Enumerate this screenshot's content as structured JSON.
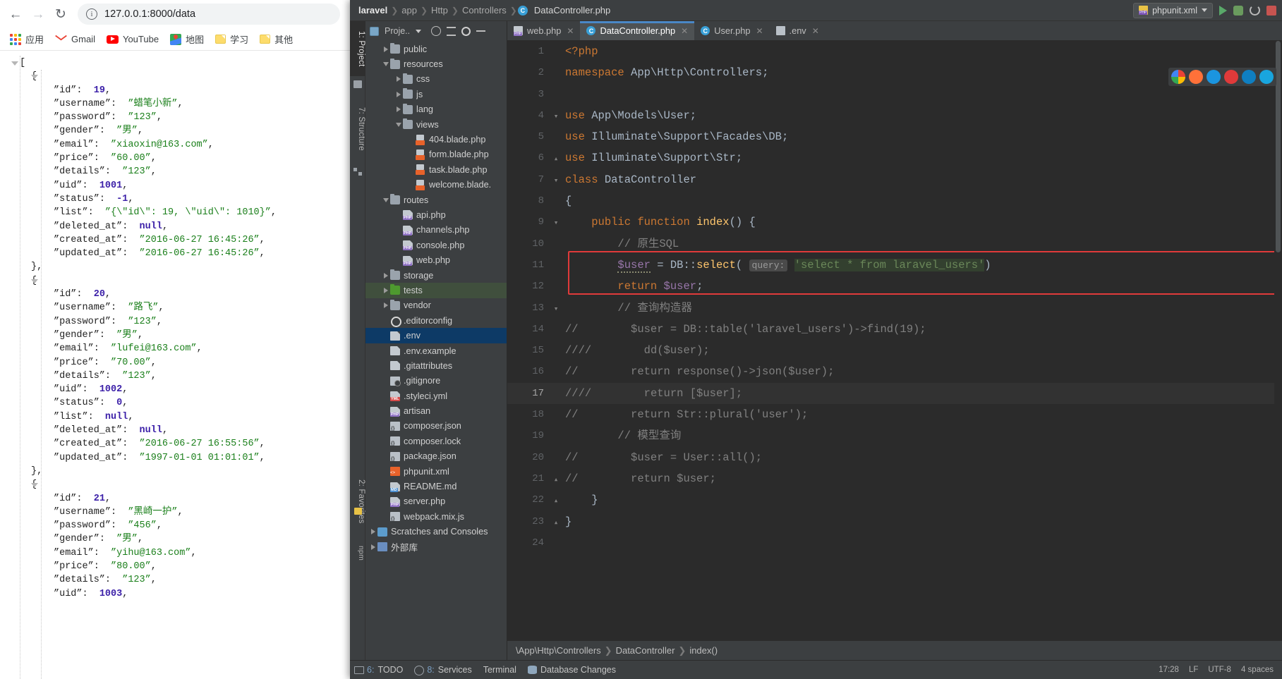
{
  "browser": {
    "nav": {
      "back_icon": "arrow-left",
      "forward_icon": "arrow-right",
      "reload_icon": "reload"
    },
    "omnibox": {
      "info_icon": "info-circle",
      "url": "127.0.0.1:8000/data"
    },
    "bookmarks": [
      {
        "label": "应用",
        "icon": "apps-grid-icon"
      },
      {
        "label": "Gmail",
        "icon": "gmail-icon"
      },
      {
        "label": "YouTube",
        "icon": "youtube-icon"
      },
      {
        "label": "地图",
        "icon": "maps-icon"
      },
      {
        "label": "学习",
        "icon": "folder-icon"
      },
      {
        "label": "其他",
        "icon": "folder-icon"
      }
    ],
    "json_response": [
      {
        "id": 19,
        "username": "蜡笔小新",
        "password": "123",
        "gender": "男",
        "email": "xiaoxin@163.com",
        "price": "60.00",
        "details": "123",
        "uid": 1001,
        "status": -1,
        "list": "{\\\"id\\\": 19, \\\"uid\\\": 1010}",
        "deleted_at": null,
        "created_at": "2016-06-27 16:45:26",
        "updated_at": "2016-06-27 16:45:26"
      },
      {
        "id": 20,
        "username": "路飞",
        "password": "123",
        "gender": "男",
        "email": "lufei@163.com",
        "price": "70.00",
        "details": "123",
        "uid": 1002,
        "status": 0,
        "list": null,
        "deleted_at": null,
        "created_at": "2016-06-27 16:55:56",
        "updated_at": "1997-01-01 01:01:01"
      },
      {
        "id": 21,
        "username": "黑崎一护",
        "password": "456",
        "gender": "男",
        "email": "yihu@163.com",
        "price": "80.00",
        "details": "123",
        "uid": 1003
      }
    ]
  },
  "ide": {
    "breadcrumb": {
      "items": [
        "laravel",
        "app",
        "Http",
        "Controllers"
      ],
      "file": "DataController.php"
    },
    "run_config": {
      "label": "phpunit.xml",
      "caret_icon": "chevron-down-icon"
    },
    "run_actions": [
      {
        "name": "run-button",
        "icon": "play-icon"
      },
      {
        "name": "debug-button",
        "icon": "bug-icon"
      },
      {
        "name": "rerun-button",
        "icon": "rerun-icon"
      },
      {
        "name": "stop-button",
        "icon": "stop-icon"
      }
    ],
    "left_strip": [
      {
        "label": "1: Project",
        "active": true
      },
      {
        "label": "7: Structure",
        "active": false
      },
      {
        "label": "2: Favorites",
        "active": false
      },
      {
        "label": "npm",
        "active": false
      }
    ],
    "project_panel": {
      "title": "Proje..",
      "toolbar_icons": [
        "project-view-icon",
        "locate-icon",
        "collapse-all-icon",
        "settings-gear-icon",
        "hide-icon"
      ],
      "tree": [
        {
          "label": "public",
          "indent": 1,
          "twisty": "right",
          "icon": "folder"
        },
        {
          "label": "resources",
          "indent": 1,
          "twisty": "down",
          "icon": "folder"
        },
        {
          "label": "css",
          "indent": 2,
          "twisty": "right",
          "icon": "folder"
        },
        {
          "label": "js",
          "indent": 2,
          "twisty": "right",
          "icon": "folder"
        },
        {
          "label": "lang",
          "indent": 2,
          "twisty": "right",
          "icon": "folder"
        },
        {
          "label": "views",
          "indent": 2,
          "twisty": "down",
          "icon": "folder"
        },
        {
          "label": "404.blade.php",
          "indent": 3,
          "twisty": "none",
          "icon": "blade"
        },
        {
          "label": "form.blade.php",
          "indent": 3,
          "twisty": "none",
          "icon": "blade"
        },
        {
          "label": "task.blade.php",
          "indent": 3,
          "twisty": "none",
          "icon": "blade"
        },
        {
          "label": "welcome.blade.",
          "indent": 3,
          "twisty": "none",
          "icon": "blade"
        },
        {
          "label": "routes",
          "indent": 1,
          "twisty": "down",
          "icon": "folder"
        },
        {
          "label": "api.php",
          "indent": 2,
          "twisty": "none",
          "icon": "php"
        },
        {
          "label": "channels.php",
          "indent": 2,
          "twisty": "none",
          "icon": "php"
        },
        {
          "label": "console.php",
          "indent": 2,
          "twisty": "none",
          "icon": "php"
        },
        {
          "label": "web.php",
          "indent": 2,
          "twisty": "none",
          "icon": "php"
        },
        {
          "label": "storage",
          "indent": 1,
          "twisty": "right",
          "icon": "folder"
        },
        {
          "label": "tests",
          "indent": 1,
          "twisty": "right",
          "icon": "folder-green",
          "green": true
        },
        {
          "label": "vendor",
          "indent": 1,
          "twisty": "right",
          "icon": "folder"
        },
        {
          "label": ".editorconfig",
          "indent": 1,
          "twisty": "none",
          "icon": "gear"
        },
        {
          "label": ".env",
          "indent": 1,
          "twisty": "none",
          "icon": "doc",
          "selected": true
        },
        {
          "label": ".env.example",
          "indent": 1,
          "twisty": "none",
          "icon": "doc"
        },
        {
          "label": ".gitattributes",
          "indent": 1,
          "twisty": "none",
          "icon": "doc"
        },
        {
          "label": ".gitignore",
          "indent": 1,
          "twisty": "none",
          "icon": "git"
        },
        {
          "label": ".styleci.yml",
          "indent": 1,
          "twisty": "none",
          "icon": "yml"
        },
        {
          "label": "artisan",
          "indent": 1,
          "twisty": "none",
          "icon": "php"
        },
        {
          "label": "composer.json",
          "indent": 1,
          "twisty": "none",
          "icon": "json"
        },
        {
          "label": "composer.lock",
          "indent": 1,
          "twisty": "none",
          "icon": "json"
        },
        {
          "label": "package.json",
          "indent": 1,
          "twisty": "none",
          "icon": "json"
        },
        {
          "label": "phpunit.xml",
          "indent": 1,
          "twisty": "none",
          "icon": "xml"
        },
        {
          "label": "README.md",
          "indent": 1,
          "twisty": "none",
          "icon": "md"
        },
        {
          "label": "server.php",
          "indent": 1,
          "twisty": "none",
          "icon": "php"
        },
        {
          "label": "webpack.mix.js",
          "indent": 1,
          "twisty": "none",
          "icon": "json"
        },
        {
          "label": "Scratches and Consoles",
          "indent": 0,
          "twisty": "right",
          "icon": "scratch"
        },
        {
          "label": "外部库",
          "indent": 0,
          "twisty": "right",
          "icon": "lib"
        }
      ]
    },
    "tabs": [
      {
        "label": "web.php",
        "icon": "php-file-icon",
        "active": false
      },
      {
        "label": "DataController.php",
        "icon": "php-class-icon",
        "active": true
      },
      {
        "label": "User.php",
        "icon": "php-class-icon",
        "active": false
      },
      {
        "label": ".env",
        "icon": "env-file-icon",
        "active": false
      }
    ],
    "editor": {
      "file": "DataController.php",
      "current_line": 17,
      "lines": [
        {
          "n": 1,
          "fold": "",
          "html": "<span class=\"kw\">&lt;?php</span>"
        },
        {
          "n": 2,
          "fold": "",
          "html": "<span class=\"kw\">namespace</span> <span class=\"txt\">App\\Http\\Controllers</span><span class=\"txt\">;</span>"
        },
        {
          "n": 3,
          "fold": "",
          "html": ""
        },
        {
          "n": 4,
          "fold": "v",
          "html": "<span class=\"kw\">use</span> <span class=\"txt\">App\\Models\\User</span><span class=\"txt\">;</span>"
        },
        {
          "n": 5,
          "fold": "",
          "html": "<span class=\"kw\">use</span> <span class=\"txt\">Illuminate\\Support\\Facades\\DB</span><span class=\"txt\">;</span>"
        },
        {
          "n": 6,
          "fold": "^",
          "html": "<span class=\"kw\">use</span> <span class=\"txt\">Illuminate\\Support\\Str</span><span class=\"txt\">;</span>"
        },
        {
          "n": 7,
          "fold": "v",
          "html": "<span class=\"kw\">class</span> <span class=\"cls\">DataController</span>"
        },
        {
          "n": 8,
          "fold": "",
          "html": "<span class=\"txt\">{</span>"
        },
        {
          "n": 9,
          "fold": "v",
          "html": "    <span class=\"kw\">public function</span> <span class=\"fn\">index</span><span class=\"txt\">() {</span>"
        },
        {
          "n": 10,
          "fold": "",
          "html": "        <span class=\"com\">// 原生SQL</span>"
        },
        {
          "n": 11,
          "fold": "",
          "html": "        <span class=\"var squiggle\">$user</span> <span class=\"txt\">=</span> <span class=\"cls\">DB</span><span class=\"txt\">::</span><span class=\"fn\">select</span><span class=\"txt\">(</span> <span class=\"hint\">query:</span> <span class=\"str sqlhl\">'select * from laravel_users'</span><span class=\"txt\">)</span>"
        },
        {
          "n": 12,
          "fold": "",
          "html": "        <span class=\"kw\">return</span> <span class=\"var\">$user</span><span class=\"txt\">;</span>"
        },
        {
          "n": 13,
          "fold": "v",
          "html": "        <span class=\"com\">// 查询构造器</span>"
        },
        {
          "n": 14,
          "fold": "",
          "html": "<span class=\"com\">//</span>        <span class=\"com\">$user = DB::table('laravel_users')-&gt;find(19);</span>"
        },
        {
          "n": 15,
          "fold": "",
          "html": "<span class=\"com\">////</span>        <span class=\"com\">dd($user);</span>"
        },
        {
          "n": 16,
          "fold": "",
          "html": "<span class=\"com\">//</span>        <span class=\"com\">return response()-&gt;json($user);</span>"
        },
        {
          "n": 17,
          "fold": "",
          "html": "<span class=\"com\">////</span>        <span class=\"com\">return [$user];</span>",
          "highlight": true
        },
        {
          "n": 18,
          "fold": "",
          "html": "<span class=\"com\">//</span>        <span class=\"com\">return Str::plural('user');</span>"
        },
        {
          "n": 19,
          "fold": "",
          "html": "        <span class=\"com\">// 模型查询</span>"
        },
        {
          "n": 20,
          "fold": "",
          "html": "<span class=\"com\">//</span>        <span class=\"com\">$user = User::all();</span>"
        },
        {
          "n": 21,
          "fold": "^",
          "html": "<span class=\"com\">//</span>        <span class=\"com\">return $user;</span>"
        },
        {
          "n": 22,
          "fold": "^",
          "html": "    <span class=\"txt\">}</span>"
        },
        {
          "n": 23,
          "fold": "^",
          "html": "<span class=\"txt\">}</span>"
        },
        {
          "n": 24,
          "fold": "",
          "html": ""
        }
      ]
    },
    "editor_breadcrumb": {
      "path": "\\App\\Http\\Controllers",
      "class": "DataController",
      "method": "index()"
    },
    "status_bar": {
      "items": [
        {
          "num": "6:",
          "label": "TODO",
          "icon": "todo-icon"
        },
        {
          "num": "8:",
          "label": "Services",
          "icon": "services-icon"
        },
        {
          "num": "",
          "label": "Terminal",
          "icon": "terminal-icon"
        },
        {
          "num": "",
          "label": "Database Changes",
          "icon": "database-icon"
        }
      ],
      "right": [
        "17:28",
        "LF",
        "UTF-8",
        "4 spaces"
      ]
    }
  },
  "colors": {
    "accent": "#4a88c7",
    "editor_bg": "#2b2b2b",
    "panel_bg": "#3c3f41",
    "selection": "#0d3a66",
    "error_box": "#e03a3a",
    "string": "#6a8759",
    "keyword": "#cc7832"
  }
}
